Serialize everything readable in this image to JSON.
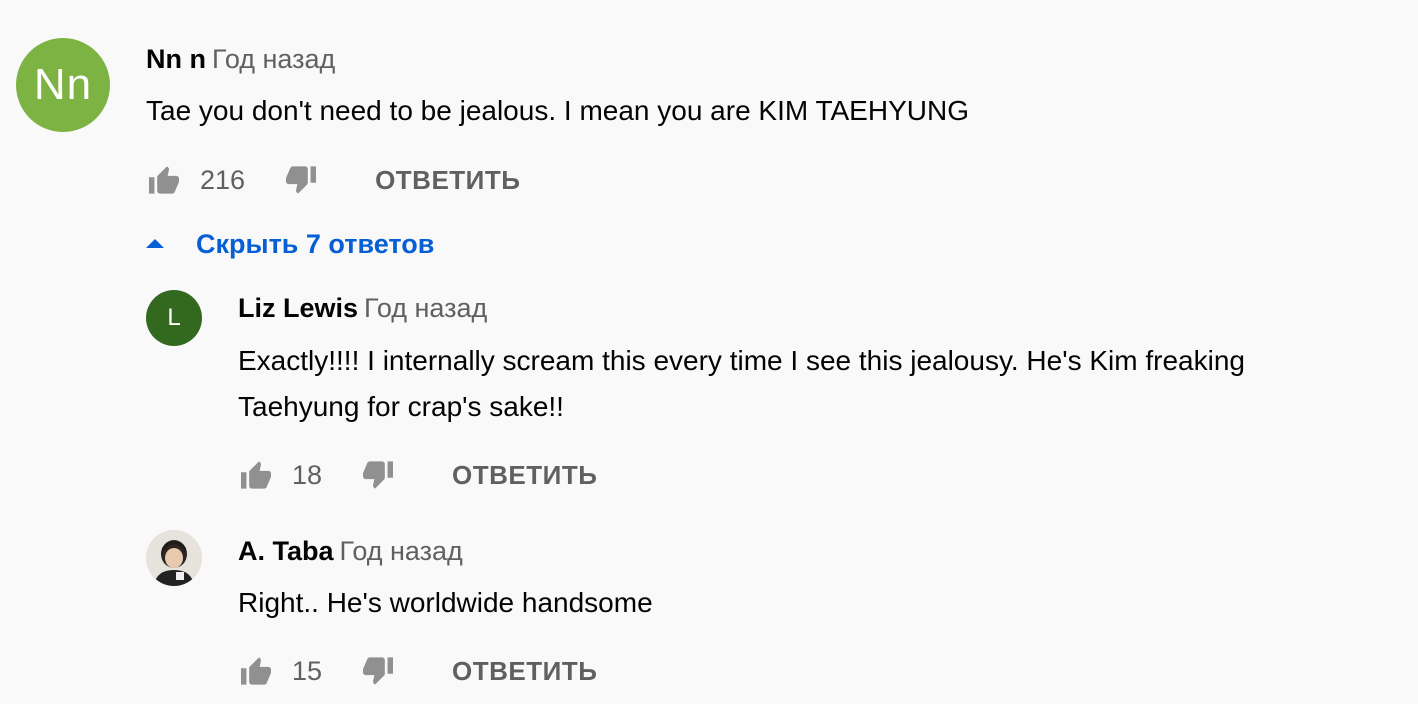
{
  "comments": [
    {
      "author": "Nn n",
      "time": "Год назад",
      "avatar_initials": "Nn",
      "avatar_color": "#7cb342",
      "text": "Tae you don't need to be jealous. I mean you are KIM TAEHYUNG",
      "likes": "216",
      "reply_label": "ОТВЕТИТЬ"
    }
  ],
  "replies_toggle": {
    "label": "Скрыть 7 ответов",
    "icon": "caret-up-icon",
    "color": "#065fd4"
  },
  "replies": [
    {
      "author": "Liz Lewis",
      "time": "Год назад",
      "avatar_initials": "L",
      "avatar_color": "#33691e",
      "text_lines": [
        "Exactly!!!!  I internally scream this every time I see this jealousy. He's Kim freaking",
        "Taehyung for crap's sake!!"
      ],
      "likes": "18",
      "reply_label": "ОТВЕТИТЬ"
    },
    {
      "author": "A. Taba",
      "time": "Год назад",
      "avatar": "photo-avatar",
      "text": "Right.. He's worldwide handsome",
      "likes": "15",
      "reply_label": "ОТВЕТИТЬ"
    }
  ],
  "icons": {
    "like": "thumb-up-icon",
    "dislike": "thumb-down-icon"
  }
}
